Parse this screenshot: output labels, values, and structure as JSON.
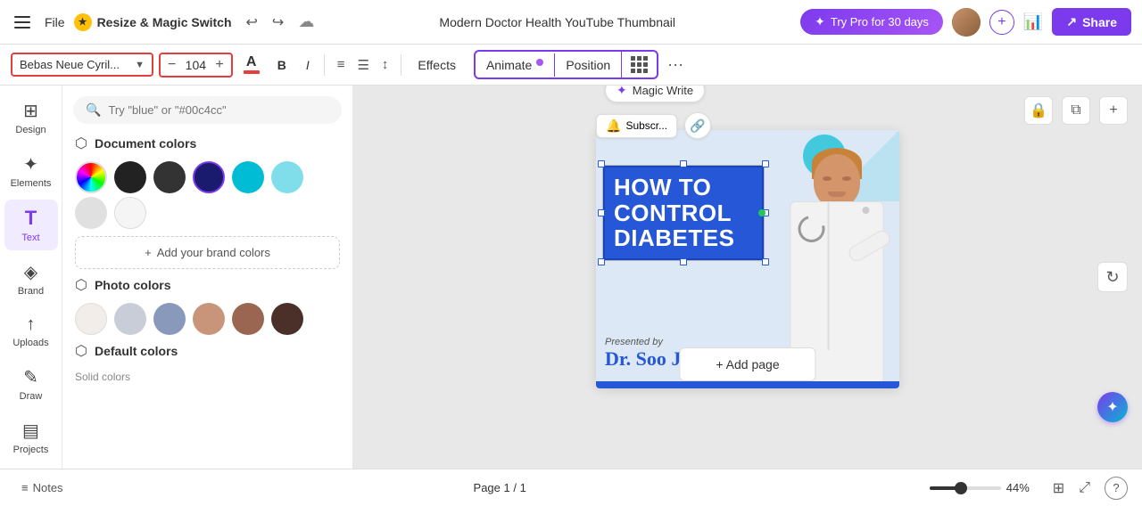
{
  "topbar": {
    "file_label": "File",
    "app_name": "Resize & Magic Switch",
    "title": "Modern Doctor Health YouTube Thumbnail",
    "pro_label": "Try Pro for 30 days",
    "share_label": "Share"
  },
  "formatbar": {
    "font_name": "Bebas Neue Cyril...",
    "font_size": "104",
    "bold_label": "B",
    "italic_label": "I",
    "effects_label": "Effects",
    "animate_label": "Animate",
    "position_label": "Position",
    "more_label": "···"
  },
  "left_nav": {
    "items": [
      {
        "id": "design",
        "label": "Design",
        "icon": "⊞"
      },
      {
        "id": "elements",
        "label": "Elements",
        "icon": "✦"
      },
      {
        "id": "text",
        "label": "Text",
        "icon": "T"
      },
      {
        "id": "brand",
        "label": "Brand",
        "icon": "◈"
      },
      {
        "id": "uploads",
        "label": "Uploads",
        "icon": "↑"
      },
      {
        "id": "draw",
        "label": "Draw",
        "icon": "✎"
      },
      {
        "id": "projects",
        "label": "Projects",
        "icon": "▤"
      }
    ]
  },
  "panel": {
    "search_placeholder": "Try \"blue\" or \"#00c4cc\"",
    "doc_colors_title": "Document colors",
    "photo_colors_title": "Photo colors",
    "default_colors_title": "Default colors",
    "solid_colors_label": "Solid colors",
    "add_brand_label": "Add your brand colors",
    "doc_colors": [
      {
        "id": "rainbow",
        "type": "rainbow"
      },
      {
        "id": "black1",
        "hex": "#222222",
        "type": "dark"
      },
      {
        "id": "black2",
        "hex": "#333333",
        "type": "dark2"
      },
      {
        "id": "navy",
        "hex": "#1a1a6e",
        "type": "navy"
      },
      {
        "id": "teal",
        "hex": "#00bcd4",
        "type": "teal"
      },
      {
        "id": "cyan",
        "hex": "#80deea",
        "type": "cyan"
      },
      {
        "id": "light1",
        "hex": "#e0e0e0",
        "type": "light1"
      },
      {
        "id": "light2",
        "hex": "#f5f5f5",
        "type": "light2"
      }
    ],
    "photo_colors": [
      {
        "id": "phwhite",
        "type": "phwhite"
      },
      {
        "id": "phlight",
        "hex": "#d8dce8",
        "type": "phlight"
      },
      {
        "id": "phblue",
        "hex": "#9baacb",
        "type": "phblue"
      },
      {
        "id": "phpink",
        "hex": "#c8967a",
        "type": "phpink"
      },
      {
        "id": "phpink2",
        "hex": "#a06e5e",
        "type": "phpink2"
      },
      {
        "id": "phbrown",
        "hex": "#5c3d2e",
        "type": "phbrown"
      }
    ]
  },
  "canvas": {
    "magic_write_label": "Magic Write",
    "subscribe_label": "Subscr...",
    "add_page_label": "+ Add page",
    "slide_title_line1": "HOW TO",
    "slide_title_line2": "CONTROL DIABETES",
    "slide_presented_by": "Presented by",
    "slide_doctor_name": "Dr. Soo Jin",
    "arrow_icon": "↻"
  },
  "bottom_bar": {
    "notes_label": "Notes",
    "page_label": "Page 1 / 1",
    "zoom_pct": "44%"
  }
}
